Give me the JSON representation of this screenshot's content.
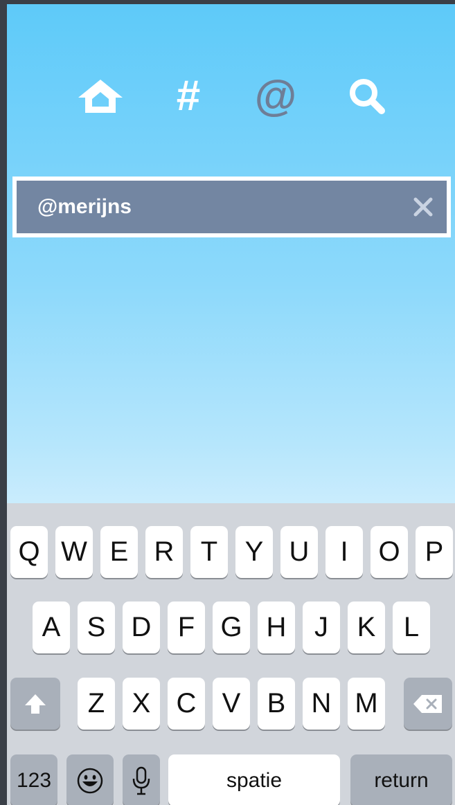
{
  "tabs": [
    {
      "name": "home",
      "icon": "home-icon"
    },
    {
      "name": "hashtags",
      "glyph": "#",
      "icon": "hash-icon"
    },
    {
      "name": "mentions",
      "glyph": "@",
      "icon": "at-icon",
      "active": true
    },
    {
      "name": "search",
      "icon": "search-icon"
    }
  ],
  "search": {
    "value": "@merijns",
    "clear_icon": "close-icon"
  },
  "keyboard": {
    "row1": [
      "Q",
      "W",
      "E",
      "R",
      "T",
      "Y",
      "U",
      "I",
      "O",
      "P"
    ],
    "row2": [
      "A",
      "S",
      "D",
      "F",
      "G",
      "H",
      "J",
      "K",
      "L"
    ],
    "row3": [
      "Z",
      "X",
      "C",
      "V",
      "B",
      "N",
      "M"
    ],
    "shift_icon": "shift-icon",
    "backspace_icon": "backspace-icon",
    "numbers_label": "123",
    "emoji_icon": "emoji-icon",
    "mic_icon": "microphone-icon",
    "space_label": "spatie",
    "return_label": "return"
  },
  "colors": {
    "sky_top": "#5ecaf9",
    "sky_bottom": "#c9ecfd",
    "search_field": "#7386a2",
    "active_tab": "#6e7e97",
    "keyboard_bg": "#d1d5db"
  }
}
